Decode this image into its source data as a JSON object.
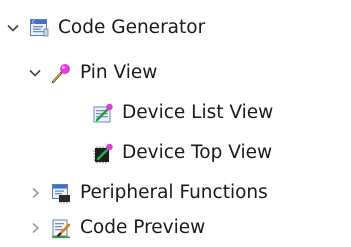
{
  "tree": {
    "items": [
      {
        "label": "Code Generator",
        "expanded": true,
        "icon": "code-generator-icon"
      },
      {
        "label": "Pin View",
        "expanded": true,
        "icon": "pin-view-icon"
      },
      {
        "label": "Device List View",
        "icon": "device-list-view-icon"
      },
      {
        "label": "Device Top View",
        "icon": "device-top-view-icon"
      },
      {
        "label": "Peripheral Functions",
        "expanded": false,
        "icon": "peripheral-functions-icon"
      },
      {
        "label": "Code Preview",
        "expanded": false,
        "icon": "code-preview-icon"
      }
    ]
  }
}
